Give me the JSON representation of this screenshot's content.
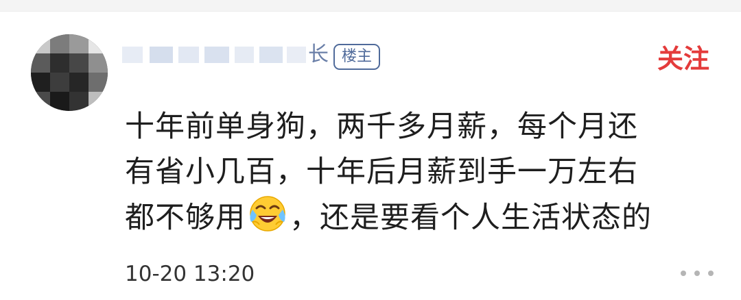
{
  "comment": {
    "author_suffix": "长",
    "owner_badge": "楼主",
    "follow_label": "关注",
    "text_lines": [
      "十年前单身狗，两千多月薪，每个月还",
      "有省小几百，十年后月薪到手一万左右",
      "都不够用",
      "，还是要看个人生活状态的"
    ],
    "emoji_icon": "laugh-cry-emoji-icon",
    "timestamp": "10-20 13:20",
    "more_icon": "ellipsis-icon"
  },
  "colors": {
    "follow_red": "#e43b3b",
    "badge_blue": "#4f6a9a",
    "body_text": "#1e1e1e",
    "meta_gray": "#b5b5b5"
  }
}
